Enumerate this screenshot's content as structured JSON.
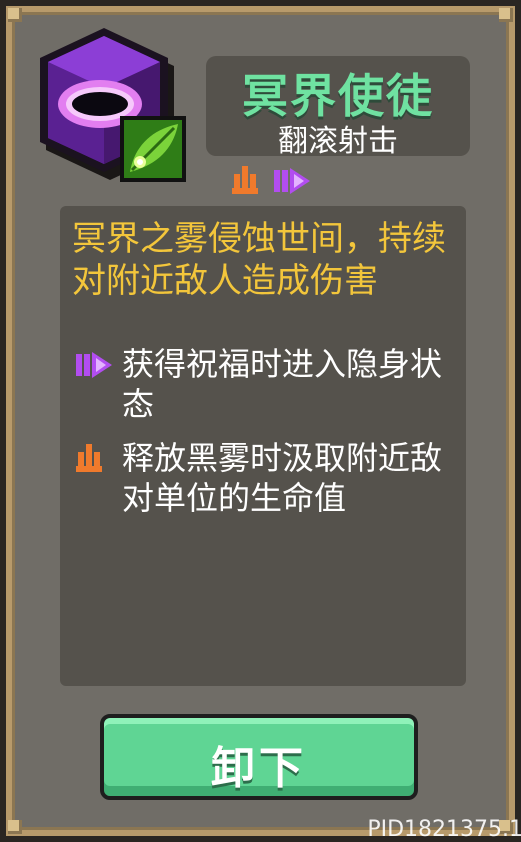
{
  "item": {
    "name": "冥界使徒",
    "skill": "翻滚射击",
    "icon": "netherworld-ring-hex-icon",
    "sub_icon": "green-leaf-skill-icon"
  },
  "tags": [
    {
      "icon": "orange-flame-icon",
      "color": "#f07a2c"
    },
    {
      "icon": "purple-dash-icon",
      "color": "#b24df0"
    }
  ],
  "description": {
    "main": "冥界之雾侵蚀世间，持续对附近敌人造成伤害",
    "effects": [
      {
        "icon": "purple-dash-icon",
        "text": "获得祝福时进入隐身状态"
      },
      {
        "icon": "orange-flame-icon",
        "text": "释放黑雾时汲取附近敌对单位的生命值"
      }
    ]
  },
  "actions": {
    "unequip_label": "卸下"
  },
  "watermark": "PID1821375.1",
  "colors": {
    "name": "#6fe2a1",
    "description": "#f3c63b",
    "button": "#5fd594",
    "frame": "#b79a6b",
    "panel": "#55524c"
  }
}
